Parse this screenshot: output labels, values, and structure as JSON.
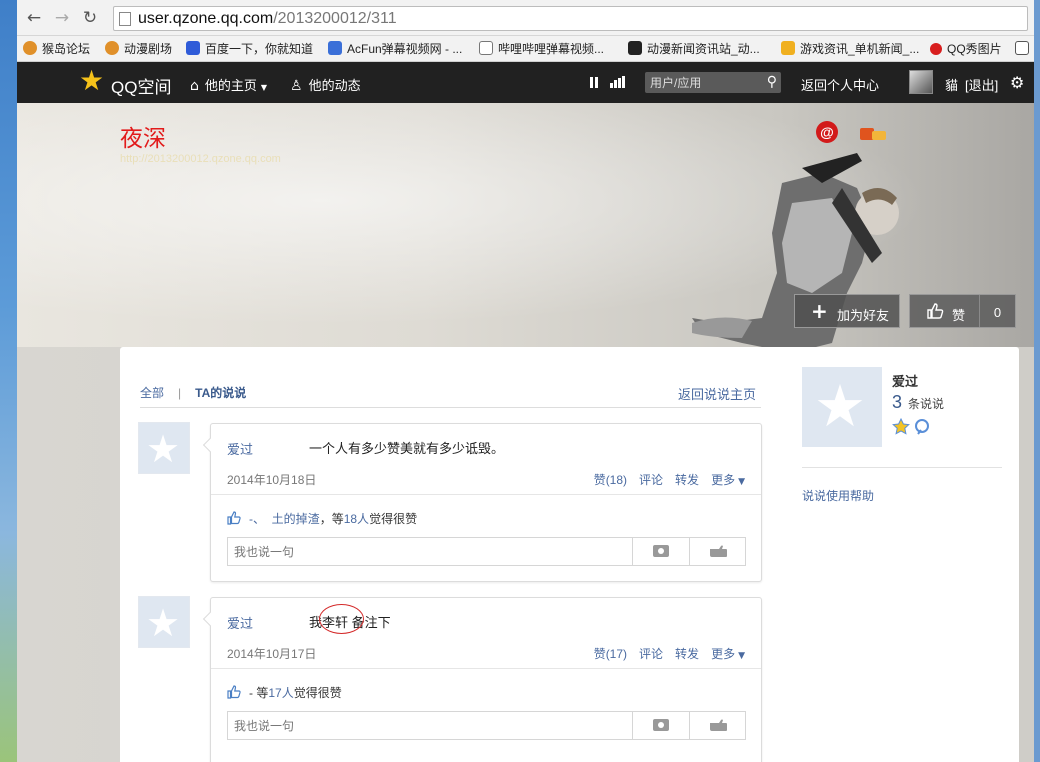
{
  "browser": {
    "url_host": "user.qzone.qq.com",
    "url_path": "/2013200012/311",
    "bookmarks": [
      {
        "label": "猴岛论坛",
        "color": "#e0902a"
      },
      {
        "label": "动漫剧场",
        "color": "#e0902a"
      },
      {
        "label": "百度一下，你就知道",
        "color": "#2f5bd8"
      },
      {
        "label": "AcFun弹幕视频网 - ...",
        "color": "#3a6fd8"
      },
      {
        "label": "哔哩哔哩弹幕视频...",
        "color": "#777777"
      },
      {
        "label": "动漫新闻资讯站_动...",
        "color": "#222222"
      },
      {
        "label": "游戏资讯_单机新闻_...",
        "color": "#f0b020"
      },
      {
        "label": "QQ秀图片",
        "color": "#d81e1e"
      }
    ]
  },
  "topbar": {
    "logo_text": "QQ空间",
    "home_label": "他的主页",
    "feed_label": "他的动态",
    "search_placeholder": "用户/应用",
    "back_center": "返回个人中心",
    "username": "貓",
    "logout": "[退出]"
  },
  "banner": {
    "site_name": "夜深",
    "site_url": "http://2013200012.qzone.qq.com",
    "add_friend": "加为好友",
    "like_label": "赞",
    "like_count": "0"
  },
  "tabs": {
    "all": "全部",
    "separator": "|",
    "mine": "TA的说说",
    "back": "返回说说主页"
  },
  "posts": [
    {
      "author": "爱过",
      "text": "一个人有多少赞美就有多少诋毁。",
      "date": "2014年10月18日",
      "like_action": "赞(18)",
      "comment_action": "评论",
      "share_action": "转发",
      "more_action": "更多",
      "likes_prefix": "-、",
      "likes_user": "土的掉渣",
      "likes_suffix_pre": "，等",
      "likes_count": "18人",
      "likes_suffix": "觉得很赞",
      "comment_placeholder": "我也说一句"
    },
    {
      "author": "爱过",
      "text": "我李轩 备注下",
      "date": "2014年10月17日",
      "like_action": "赞(17)",
      "comment_action": "评论",
      "share_action": "转发",
      "more_action": "更多",
      "likes_prefix": "- 等",
      "likes_count": "17人",
      "likes_suffix": "觉得很赞",
      "comment_placeholder": "我也说一句"
    }
  ],
  "sidebar": {
    "name": "爱过",
    "count": "3",
    "count_label": "条说说",
    "help": "说说使用帮助"
  }
}
